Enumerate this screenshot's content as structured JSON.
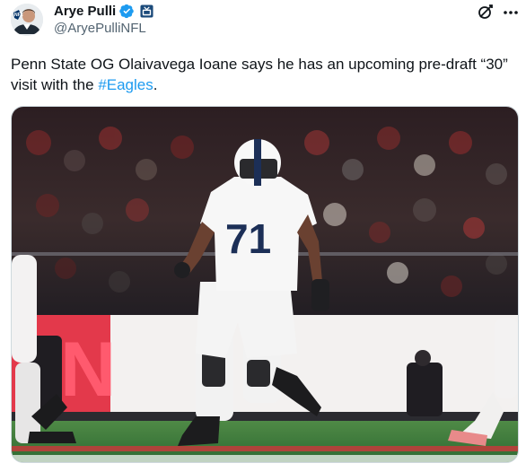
{
  "author": {
    "display_name": "Arye Pulli",
    "handle": "@AryePulliNFL",
    "verified": true,
    "affiliate_badge_icon": "broadcast-badge-icon"
  },
  "tweet": {
    "text_before": "Penn State OG Olaivavega Ioane says he has an upcoming pre-draft “30” visit with the ",
    "hashtag": "#Eagles",
    "text_after": "."
  },
  "media": {
    "jersey_number": "71",
    "banner_letter": "N"
  },
  "colors": {
    "link": "#1d9bf0",
    "verified": "#1d9bf0",
    "secondary_text": "#536471"
  },
  "icons": {
    "grok": "grok-icon",
    "more": "more-options-icon"
  }
}
